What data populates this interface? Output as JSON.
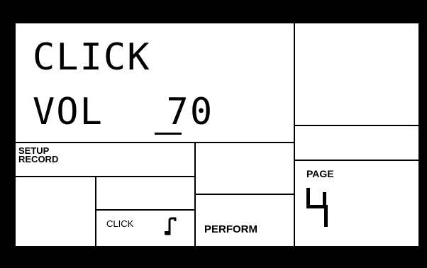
{
  "display": {
    "line1": "CLICK",
    "line2_label": "VOL",
    "line2_value": "70"
  },
  "menu": {
    "setup_line1": "SETUP",
    "setup_line2": "RECORD",
    "click": "CLICK",
    "perform": "PERFORM",
    "page_label": "PAGE",
    "page_number": "4"
  },
  "icons": {
    "click_icon": "music-note-icon"
  }
}
